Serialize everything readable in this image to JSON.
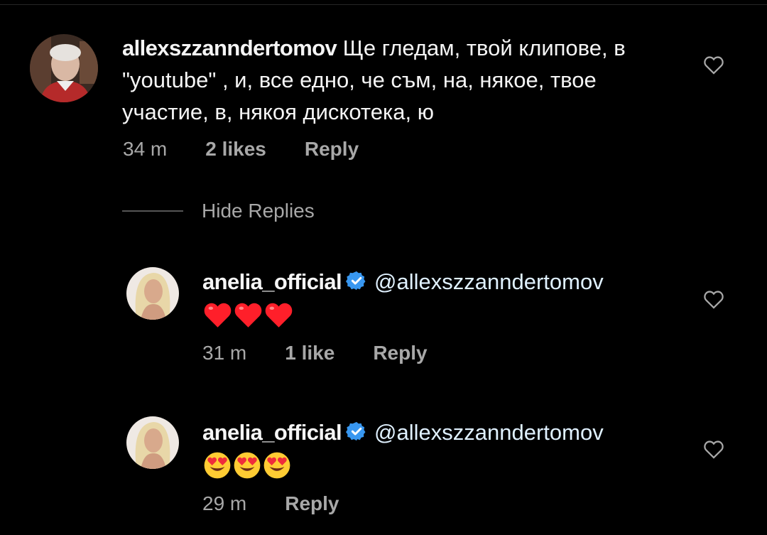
{
  "comment": {
    "username": "allexszzanndertomov",
    "text": "Ще гледам, твой клипове, в \"youtube\" , и, все едно, че съм, на, някое, твое участие, в, някоя дискотека, ю",
    "time": "34 m",
    "likes": "2 likes",
    "reply_label": "Reply"
  },
  "hide_replies_label": "Hide Replies",
  "replies": [
    {
      "username": "anelia_official",
      "mention": "@allexszzanndertomov",
      "emoji": [
        "red-heart",
        "red-heart",
        "red-heart"
      ],
      "time": "31 m",
      "likes": "1 like",
      "reply_label": "Reply"
    },
    {
      "username": "anelia_official",
      "mention": "@allexszzanndertomov",
      "emoji": [
        "heart-eyes",
        "heart-eyes",
        "heart-eyes"
      ],
      "time": "29 m",
      "likes": "",
      "reply_label": "Reply"
    }
  ],
  "colors": {
    "background": "#000000",
    "text": "#f5f5f5",
    "meta": "#a8a8a8",
    "verified_badge": "#3897f0"
  }
}
